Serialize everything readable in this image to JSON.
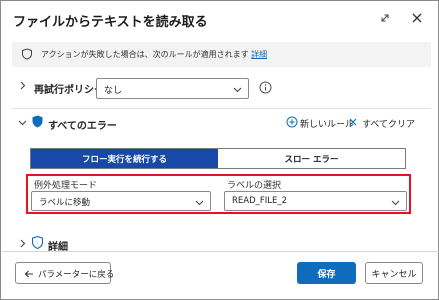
{
  "dialog": {
    "title": "ファイルからテキストを読み取る"
  },
  "info_bar": {
    "text": "アクションが失敗した場合は、次のルールが適用されます",
    "link": "詳細"
  },
  "retry": {
    "label": "再試行ポリシー",
    "value": "なし"
  },
  "errors": {
    "label": "すべてのエラー",
    "new_rule": "新しいルール",
    "clear_all": "すべてクリア",
    "segments": [
      {
        "label": "フロー実行を続行する",
        "selected": true
      },
      {
        "label": "スロー エラー",
        "selected": false
      }
    ],
    "mode": {
      "label": "例外処理モード",
      "value": "ラベルに移動"
    },
    "label_select": {
      "label": "ラベルの選択",
      "value": "READ_FILE_2"
    }
  },
  "details": {
    "label": "詳細"
  },
  "footer": {
    "back_label": "パラメーターに戻る",
    "save_label": "保存",
    "cancel_label": "キャンセル"
  },
  "colors": {
    "accent": "#0f6cbd",
    "segment_active": "#1849a9",
    "highlight_box": "#e81123"
  },
  "icons": {
    "expand": "expand-icon",
    "close": "close-icon",
    "info_shield": "shield-icon",
    "retry_info": "info-circle-icon",
    "new_rule": "add-circle-icon",
    "clear": "close-icon",
    "back": "arrow-left-icon"
  }
}
